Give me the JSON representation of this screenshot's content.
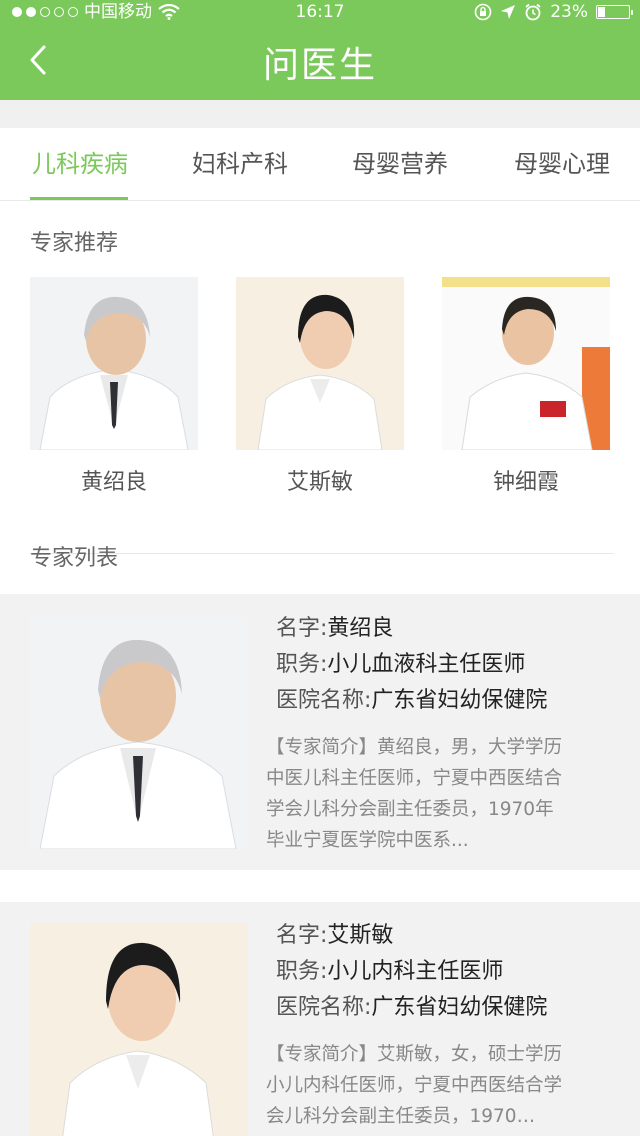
{
  "status": {
    "carrier": "中国移动",
    "time": "16:17",
    "battery": "23%",
    "battery_level": 0.23
  },
  "nav": {
    "title": "问医生",
    "back_icon": "chevron-left-icon"
  },
  "tabs": [
    {
      "label": "儿科疾病",
      "active": true
    },
    {
      "label": "妇科产科",
      "active": false
    },
    {
      "label": "母婴营养",
      "active": false
    },
    {
      "label": "母婴心理",
      "active": false
    }
  ],
  "recommend": {
    "heading": "专家推荐",
    "experts": [
      {
        "name": "黄绍良"
      },
      {
        "name": "艾斯敏"
      },
      {
        "name": "钟细霞"
      }
    ]
  },
  "list": {
    "heading": "专家列表",
    "items": [
      {
        "name_label": "名字:",
        "name": "黄绍良",
        "title_label": "职务:",
        "title": "小儿血液科主任医师",
        "hospital_label": "医院名称:",
        "hospital": "广东省妇幼保健院",
        "bio_lines": [
          "【专家简介】黄绍良，男，大学学历",
          "中医儿科主任医师，宁夏中西医结合",
          "学会儿科分会副主任委员，1970年",
          "毕业宁夏医学院中医系..."
        ]
      },
      {
        "name_label": "名字:",
        "name": "艾斯敏",
        "title_label": "职务:",
        "title": "小儿内科主任医师",
        "hospital_label": "医院名称:",
        "hospital": "广东省妇幼保健院",
        "bio_lines": [
          "【专家简介】艾斯敏，女，硕士学历",
          "小儿内科任医师，宁夏中西医结合学",
          "会儿科分会副主任委员，1970…"
        ]
      }
    ]
  }
}
